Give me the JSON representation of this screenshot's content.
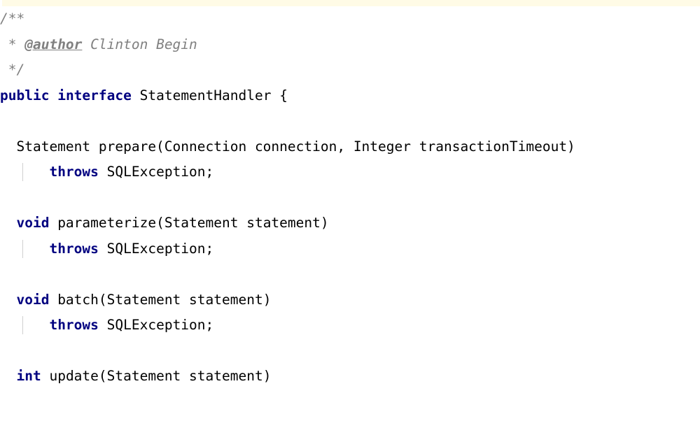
{
  "editor": {
    "language": "java",
    "colors": {
      "background": "#ffffff",
      "keyword": "#000080",
      "comment": "#808080",
      "text": "#000000",
      "selected_line": "#fffbe6",
      "indent_guide": "#d0d0d0"
    },
    "lines": [
      {
        "id": "l1",
        "segments": [
          {
            "cls": "cmt",
            "text": "/**"
          }
        ]
      },
      {
        "id": "l2",
        "segments": [
          {
            "cls": "cmt",
            "text": " * "
          },
          {
            "cls": "tag",
            "text": "@author"
          },
          {
            "cls": "cmt",
            "text": " Clinton Begin"
          }
        ]
      },
      {
        "id": "l3",
        "segments": [
          {
            "cls": "cmt",
            "text": " */"
          }
        ]
      },
      {
        "id": "l4",
        "segments": [
          {
            "cls": "kw",
            "text": "public"
          },
          {
            "cls": "txt",
            "text": " "
          },
          {
            "cls": "kw",
            "text": "interface"
          },
          {
            "cls": "txt",
            "text": " StatementHandler {"
          }
        ]
      },
      {
        "id": "l5",
        "segments": []
      },
      {
        "id": "l6",
        "segments": [
          {
            "cls": "txt",
            "text": "  Statement prepare(Connection connection, Integer transactionTimeout)"
          }
        ]
      },
      {
        "id": "l7",
        "segments": [
          {
            "cls": "txt",
            "text": "      "
          },
          {
            "cls": "kw",
            "text": "throws"
          },
          {
            "cls": "txt",
            "text": " SQLException;"
          }
        ]
      },
      {
        "id": "l8",
        "segments": []
      },
      {
        "id": "l9",
        "segments": [
          {
            "cls": "txt",
            "text": "  "
          },
          {
            "cls": "kw",
            "text": "void"
          },
          {
            "cls": "txt",
            "text": " parameterize(Statement statement)"
          }
        ]
      },
      {
        "id": "l10",
        "segments": [
          {
            "cls": "txt",
            "text": "      "
          },
          {
            "cls": "kw",
            "text": "throws"
          },
          {
            "cls": "txt",
            "text": " SQLException;"
          }
        ]
      },
      {
        "id": "l11",
        "segments": []
      },
      {
        "id": "l12",
        "segments": [
          {
            "cls": "txt",
            "text": "  "
          },
          {
            "cls": "kw",
            "text": "void"
          },
          {
            "cls": "txt",
            "text": " batch(Statement statement)"
          }
        ]
      },
      {
        "id": "l13",
        "segments": [
          {
            "cls": "txt",
            "text": "      "
          },
          {
            "cls": "kw",
            "text": "throws"
          },
          {
            "cls": "txt",
            "text": " SQLException;"
          }
        ]
      },
      {
        "id": "l14",
        "segments": []
      },
      {
        "id": "l15",
        "segments": [
          {
            "cls": "txt",
            "text": "  "
          },
          {
            "cls": "kw",
            "text": "int"
          },
          {
            "cls": "txt",
            "text": " update(Statement statement)"
          }
        ]
      }
    ]
  }
}
